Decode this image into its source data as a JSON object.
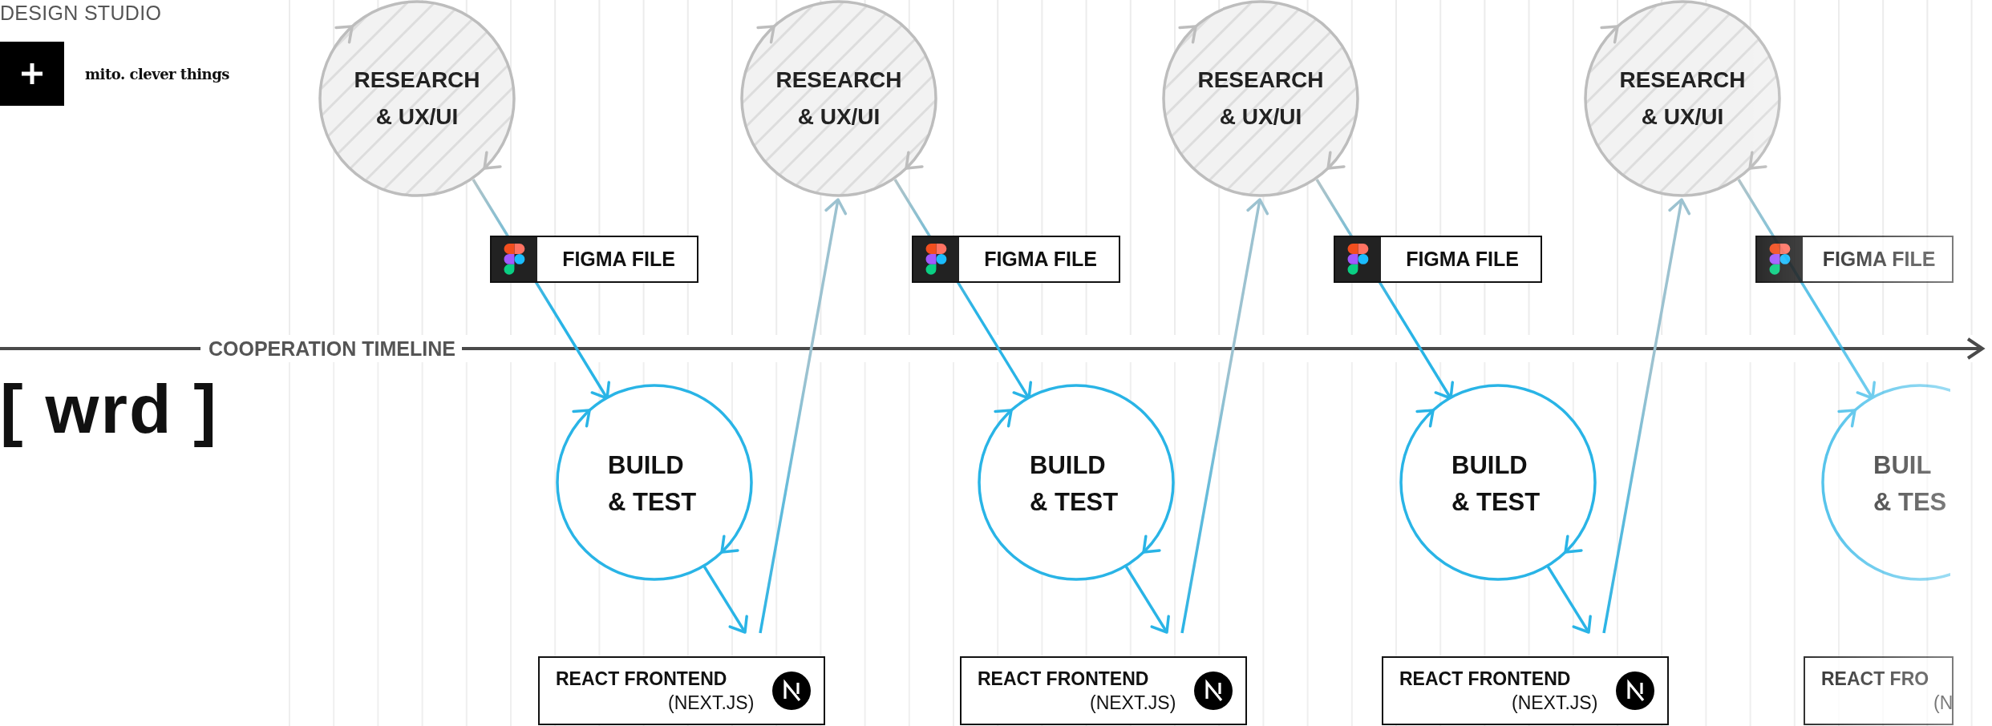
{
  "header": {
    "studio_label": "DESIGN STUDIO",
    "partner_name": "mito. clever things",
    "brand": "[ wrd ]"
  },
  "timeline": {
    "label": "COOPERATION TIMELINE"
  },
  "cycles": [
    {
      "faded": false,
      "research_lines": [
        "RESEARCH",
        "& UX/UI"
      ],
      "file_label": "FIGMA FILE",
      "build_lines": [
        "BUILD",
        "& TEST"
      ],
      "frontend_title": "REACT FRONTEND",
      "frontend_subtitle": "(NEXT.JS)"
    },
    {
      "faded": false,
      "research_lines": [
        "RESEARCH",
        "& UX/UI"
      ],
      "file_label": "FIGMA FILE",
      "build_lines": [
        "BUILD",
        "& TEST"
      ],
      "frontend_title": "REACT FRONTEND",
      "frontend_subtitle": "(NEXT.JS)"
    },
    {
      "faded": false,
      "research_lines": [
        "RESEARCH",
        "& UX/UI"
      ],
      "file_label": "FIGMA FILE",
      "build_lines": [
        "BUILD",
        "& TEST"
      ],
      "frontend_title": "REACT FRONTEND",
      "frontend_subtitle": "(NEXT.JS)"
    },
    {
      "faded": true,
      "research_lines": [
        "RESEARCH",
        "& UX/UI"
      ],
      "file_label": "FIGMA FILE",
      "build_lines": [
        "BUIL",
        "& TES"
      ],
      "frontend_title": "REACT FRO",
      "frontend_subtitle": "(N"
    }
  ]
}
